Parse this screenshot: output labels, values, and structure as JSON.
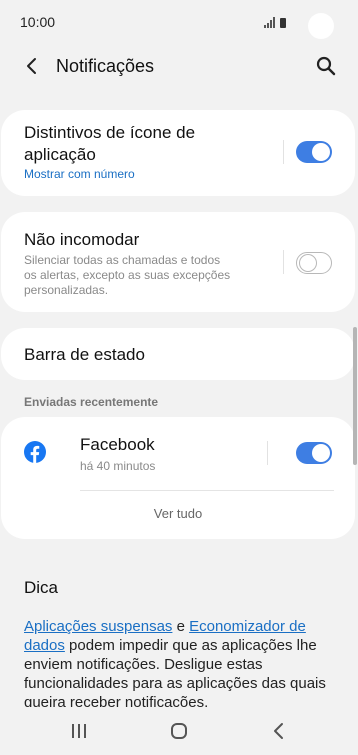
{
  "status_bar": {
    "time": "10:00"
  },
  "header": {
    "title": "Notificações",
    "back_icon": "back-arrow-icon",
    "search_icon": "search-icon"
  },
  "settings": {
    "badges": {
      "title_line1": "Distintivos de ícone de",
      "title_line2": "aplicação",
      "subtitle": "Mostrar com número",
      "enabled": true
    },
    "dnd": {
      "title": "Não incomodar",
      "desc_line1": "Silenciar todas as chamadas e todos",
      "desc_line2": "os alertas, excepto as suas excepções",
      "desc_line3": "personalizadas.",
      "enabled": false
    },
    "status_bar_item": {
      "title": "Barra de estado"
    }
  },
  "recent": {
    "label": "Enviadas recentemente",
    "apps": [
      {
        "name": "Facebook",
        "time": "há 40 minutos",
        "icon": "facebook-icon",
        "enabled": true
      }
    ],
    "see_all": "Ver tudo"
  },
  "tip": {
    "title": "Dica",
    "link1": "Aplicações suspensas",
    "connector": " e ",
    "link2": "Economizador de dados",
    "text": " podem impedir que as aplicações lhe enviem notificações. Desligue estas funcionalidades para as aplicações das quais queira receber notificações."
  },
  "colors": {
    "accent": "#3e7ee3",
    "link": "#1a6fc4",
    "background": "#f2f2f2",
    "facebook": "#1877f2"
  },
  "nav": {
    "recents_icon": "recents-icon",
    "home_icon": "home-icon",
    "back_icon": "back-icon"
  }
}
